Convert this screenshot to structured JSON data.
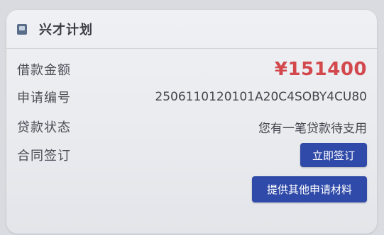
{
  "header": {
    "icon": "book-icon",
    "title": "兴才计划"
  },
  "rows": [
    {
      "label": "借款金额",
      "value": "¥151400"
    },
    {
      "label": "申请编号",
      "value": "2506110120101A20C4SOBY4CU80"
    },
    {
      "label": "贷款状态",
      "value": "您有一笔贷款待支用"
    },
    {
      "label": "合同签订"
    }
  ],
  "buttons": {
    "sign_label": "立即签订",
    "more_materials_label": "提供其他申请材料"
  },
  "colors": {
    "amount": "#d2484d",
    "button": "#2f4aa8",
    "card_bg": "#eceef2"
  }
}
